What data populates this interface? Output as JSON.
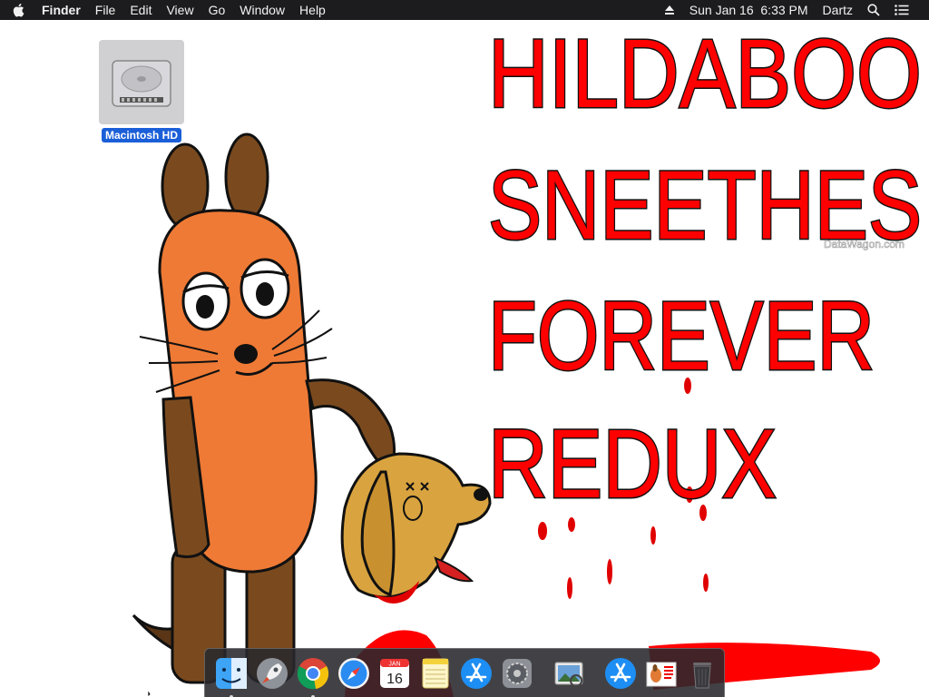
{
  "menubar": {
    "app_name": "Finder",
    "menus": [
      "File",
      "Edit",
      "View",
      "Go",
      "Window",
      "Help"
    ],
    "datetime": "Sun Jan 16  6:33 PM",
    "user": "Dartz"
  },
  "desktop": {
    "icons": [
      {
        "label": "Macintosh HD",
        "icon": "hard-drive-icon"
      }
    ]
  },
  "wallpaper": {
    "headline_lines": [
      "HILDABOO",
      "SNEETHES",
      "FOREVER",
      "REDUX"
    ],
    "watermark": "DataWagon.com",
    "headline_color": "#ff0000"
  },
  "dock": {
    "apps": [
      {
        "name": "Finder",
        "icon": "finder-icon",
        "running": true
      },
      {
        "name": "Launchpad",
        "icon": "launchpad-icon",
        "running": false
      },
      {
        "name": "Google Chrome",
        "icon": "chrome-icon",
        "running": true
      },
      {
        "name": "Safari",
        "icon": "safari-icon",
        "running": false
      },
      {
        "name": "Calendar",
        "icon": "calendar-icon",
        "running": false,
        "month": "JAN",
        "day": "16"
      },
      {
        "name": "Notes",
        "icon": "notes-icon",
        "running": false
      },
      {
        "name": "App Store",
        "icon": "app-store-icon",
        "running": false
      },
      {
        "name": "System Preferences",
        "icon": "system-preferences-icon",
        "running": false
      },
      {
        "name": "Preview",
        "icon": "preview-icon",
        "running": false
      }
    ],
    "others": [
      {
        "name": "Applications",
        "icon": "applications-folder-icon"
      },
      {
        "name": "Downloads",
        "icon": "downloads-stack-icon"
      },
      {
        "name": "Trash",
        "icon": "trash-icon"
      }
    ]
  }
}
